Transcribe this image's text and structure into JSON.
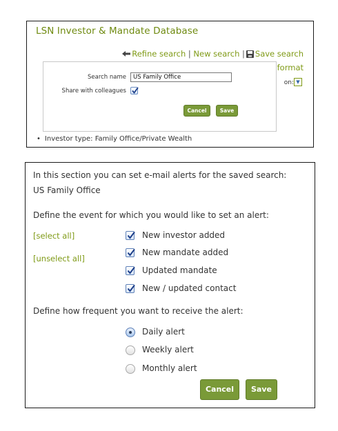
{
  "top_panel": {
    "title": "LSN Investor & Mandate Database",
    "refine_search": "Refine search",
    "separator": "|",
    "new_search": "New search",
    "save_search": "Save search",
    "format": "format",
    "option_label": "on:",
    "option_value": "▼",
    "bullet": "•",
    "investor_type": "Investor type: Family Office/Private Wealth",
    "dialog": {
      "search_name_label": "Search name",
      "search_name_value": "US Family Office",
      "share_label": "Share with colleagues",
      "share_checked": true,
      "cancel_label": "Cancel",
      "save_label": "Save"
    }
  },
  "alerts_panel": {
    "intro": "In this section you can set e-mail alerts for the saved search:",
    "search_name": "US Family Office",
    "event_prompt": "Define the event for which you would like to set an alert:",
    "select_all": "[select all]",
    "unselect_all": "[unselect all]",
    "events": [
      {
        "label": "New investor added",
        "checked": true
      },
      {
        "label": "New mandate added",
        "checked": true
      },
      {
        "label": "Updated mandate",
        "checked": true
      },
      {
        "label": "New / updated contact",
        "checked": true
      }
    ],
    "frequency_prompt": "Define how frequent you want to receive the alert:",
    "frequencies": [
      {
        "label": "Daily alert",
        "selected": true
      },
      {
        "label": "Weekly alert",
        "selected": false
      },
      {
        "label": "Monthly alert",
        "selected": false
      }
    ],
    "cancel_label": "Cancel",
    "save_label": "Save"
  },
  "colors": {
    "accent_text": "#7f9a16",
    "button": "#7a9a38",
    "border": "#1a1a1a"
  }
}
